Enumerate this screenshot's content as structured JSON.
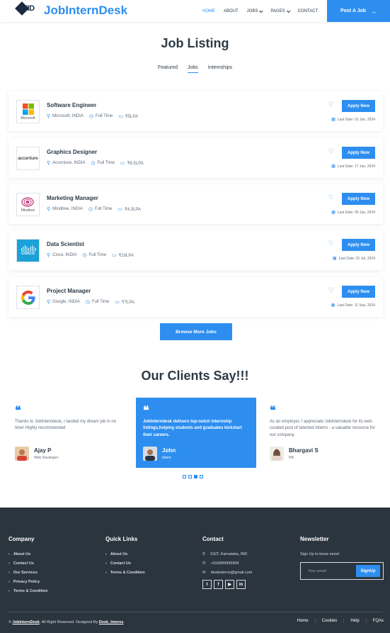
{
  "header": {
    "logo_mark": "JID",
    "brand": "JobInternDesk",
    "nav": [
      {
        "label": "HOME",
        "active": true
      },
      {
        "label": "ABOUT"
      },
      {
        "label": "JOBS",
        "dropdown": true
      },
      {
        "label": "PAGES",
        "dropdown": true
      },
      {
        "label": "CONTACT"
      }
    ],
    "post_job": "Post A Job"
  },
  "listing": {
    "title": "Job Listing",
    "tabs": [
      "Featured",
      "Jobs",
      "Internships"
    ],
    "active_tab": "Jobs",
    "jobs": [
      {
        "company_logo": "Microsoft",
        "title": "Software Engineer",
        "location": "Microsoft, INDIA",
        "type": "Full Time",
        "salary": "₹5LPA",
        "apply": "Apply Now",
        "deadline": "Last Date: 01 Jan, 2024"
      },
      {
        "company_logo": "accenture",
        "title": "Graphics Designer",
        "location": "Accenture, INDIA",
        "type": "Full Time",
        "salary": "₹6.5LPA",
        "apply": "Apply Now",
        "deadline": "Last Date: 17 Jan, 2024"
      },
      {
        "company_logo": "Mindtree",
        "title": "Marketing Manager",
        "location": "Mindtree, INDIA",
        "type": "Full Time",
        "salary": "₹4.3LPA",
        "apply": "Apply Now",
        "deadline": "Last Date: 06 Jan, 2024"
      },
      {
        "company_logo": "CISCO",
        "title": "Data Scientist",
        "location": "Cisco, INDIA",
        "type": "Full Time",
        "salary": "₹10LPA",
        "apply": "Apply Now",
        "deadline": "Last Date: 31 Jul, 2024"
      },
      {
        "company_logo": "G",
        "title": "Project Manager",
        "location": "Google, INDIA",
        "type": "Full Time",
        "salary": "₹7LPA",
        "apply": "Apply Now",
        "deadline": "Last Date: 11 Sep, 2024"
      }
    ],
    "browse": "Browse More Jobs"
  },
  "clients": {
    "title": "Our Clients Say!!!",
    "testimonials": [
      {
        "text": "Thanks to JobInterndesk, I landed my dream job in no time! Highly recommended",
        "name": "Ajay P",
        "role": "Web Developer",
        "featured": false
      },
      {
        "text": "JobInterndesk delivers top-notch internship listings,helping students and graduates kickstart their careers.",
        "name": "John",
        "role": "Intern",
        "featured": true
      },
      {
        "text": "As an employer, I appreciate JobInterndesk for its well-curated pool of talented interns - a valuable resource for our company.",
        "name": "Bhargavi S",
        "role": "HR",
        "featured": false
      }
    ],
    "dots_total": 4,
    "dots_active_index": 2
  },
  "footer": {
    "company": {
      "title": "Company",
      "links": [
        "About Us",
        "Contact Us",
        "Our Services",
        "Privacy Policy",
        "Terms & Condition"
      ]
    },
    "quick_links": {
      "title": "Quick Links",
      "links": [
        "About Us",
        "Contact Us",
        "Terms & Condition"
      ]
    },
    "contact": {
      "title": "Contact",
      "address": "SSIT, Karnataka, IND",
      "phone": "+919999999999",
      "email": "deskinterns@gmail.com",
      "socials": [
        "twitter",
        "facebook",
        "youtube",
        "linkedin"
      ]
    },
    "newsletter": {
      "title": "Newsletter",
      "text": "Sign Up to know more!",
      "placeholder": "Your email",
      "button": "SignUp"
    },
    "copyright": {
      "brand": "JobInternDesk",
      "middle": ", All Right Reserved. Designed By ",
      "designer": "Desk_Interns"
    },
    "bottom_links": [
      "Home",
      "Cookies",
      "Help",
      "FQAs"
    ]
  },
  "colors": {
    "accent": "#2d8ef0",
    "dark": "#2b353e",
    "text": "#2c3a47"
  }
}
